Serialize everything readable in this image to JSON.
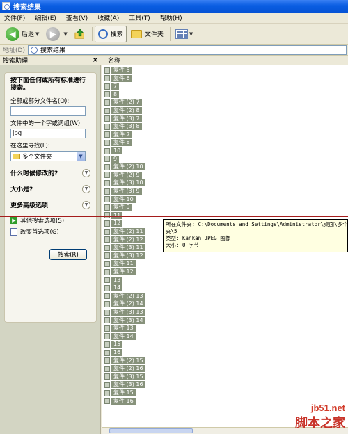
{
  "window": {
    "title": "搜索结果"
  },
  "menu": [
    "文件(F)",
    "编辑(E)",
    "查看(V)",
    "收藏(A)",
    "工具(T)",
    "帮助(H)"
  ],
  "toolbar": {
    "back": "后退",
    "search": "搜索",
    "folders": "文件夹"
  },
  "address": {
    "label": "地址(D)",
    "value": "搜索结果"
  },
  "search_pane": {
    "title": "搜索助理",
    "prompt": "按下面任何或所有标准进行搜索。",
    "filename_label": "全部或部分文件名(O):",
    "filename_value": "",
    "text_label": "文件中的一个字或词组(W):",
    "text_value": "jpg",
    "lookin_label": "在这里寻找(L):",
    "lookin_value": "多个文件夹",
    "when_modified": "什么时候修改的?",
    "size": "大小是?",
    "more_options": "更多高级选项",
    "other_options": "其他搜索选项(S)",
    "change_prefs": "改变首选项(G)",
    "search_button": "搜索(R)"
  },
  "list": {
    "column": "名称",
    "items": [
      "复件 5",
      "复件 6",
      "7",
      "8",
      "复件 (2) 7",
      "复件 (2) 8",
      "复件 (3) 7",
      "复件 (3) 8",
      "复件 7",
      "复件 8",
      "10",
      "9",
      "复件 (2) 10",
      "复件 (2) 9",
      "复件 (3) 10",
      "复件 (3) 9",
      "复件 10",
      "复件 9",
      "11",
      "12",
      "复件 (2) 11",
      "复件 (2) 12",
      "复件 (3) 11",
      "复件 (3) 12",
      "复件 11",
      "复件 12",
      "13",
      "14",
      "复件 (2) 13",
      "复件 (2) 14",
      "复件 (3) 13",
      "复件 (3) 14",
      "复件 13",
      "复件 14",
      "15",
      "16",
      "复件 (2) 15",
      "复件 (2) 16",
      "复件 (3) 15",
      "复件 (3) 16",
      "复件 15",
      "复件 16"
    ]
  },
  "tooltip": {
    "line1": "所在文件夹: C:\\Documents and Settings\\Administrator\\桌面\\多个",
    "line2": "夹\\5",
    "line3": "类型: Kankan JPEG 图像",
    "line4": "大小: 0 字节"
  },
  "watermark": {
    "site": "jb51.net",
    "name": "脚本之家"
  }
}
